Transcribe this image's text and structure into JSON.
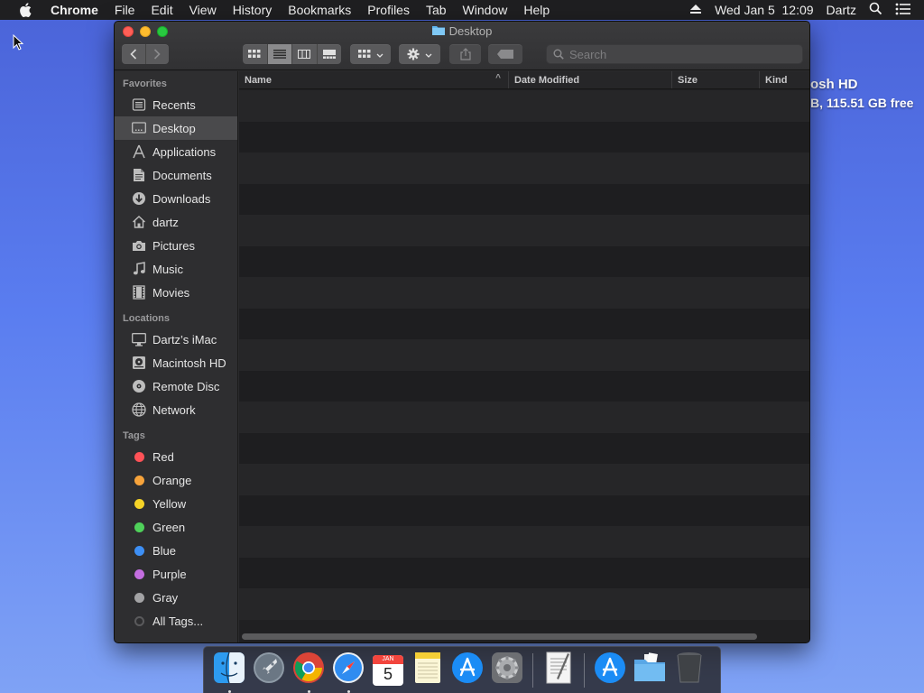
{
  "menubar": {
    "app_name": "Chrome",
    "items": [
      "File",
      "Edit",
      "View",
      "History",
      "Bookmarks",
      "Profiles",
      "Tab",
      "Window",
      "Help"
    ],
    "clock": "Wed Jan 5  12:09",
    "user": "Dartz"
  },
  "desktop": {
    "drive_name": "osh HD",
    "drive_capacity": "B, 115.51 GB free"
  },
  "window": {
    "title": "Desktop",
    "search_placeholder": "Search",
    "columns": [
      {
        "label": "Name"
      },
      {
        "label": "Date Modified"
      },
      {
        "label": "Size"
      },
      {
        "label": "Kind"
      }
    ]
  },
  "sidebar": {
    "favorites_label": "Favorites",
    "favorites": [
      {
        "label": "Recents",
        "icon": "recents-icon"
      },
      {
        "label": "Desktop",
        "icon": "desktop-icon",
        "selected": true
      },
      {
        "label": "Applications",
        "icon": "applications-icon"
      },
      {
        "label": "Documents",
        "icon": "documents-icon"
      },
      {
        "label": "Downloads",
        "icon": "downloads-icon"
      },
      {
        "label": "dartz",
        "icon": "home-icon"
      },
      {
        "label": "Pictures",
        "icon": "camera-icon"
      },
      {
        "label": "Music",
        "icon": "music-note-icon"
      },
      {
        "label": "Movies",
        "icon": "film-icon"
      }
    ],
    "locations_label": "Locations",
    "locations": [
      {
        "label": "Dartz’s iMac",
        "icon": "imac-icon"
      },
      {
        "label": "Macintosh HD",
        "icon": "hard-drive-icon"
      },
      {
        "label": "Remote Disc",
        "icon": "disc-icon"
      },
      {
        "label": "Network",
        "icon": "network-globe-icon"
      }
    ],
    "tags_label": "Tags",
    "tags": [
      {
        "label": "Red",
        "color": "#ff5257"
      },
      {
        "label": "Orange",
        "color": "#f7a33b"
      },
      {
        "label": "Yellow",
        "color": "#f5d327"
      },
      {
        "label": "Green",
        "color": "#4fd15a"
      },
      {
        "label": "Blue",
        "color": "#3d8ff5"
      },
      {
        "label": "Purple",
        "color": "#c46ee0"
      },
      {
        "label": "Gray",
        "color": "#a3a3a5"
      },
      {
        "label": "All Tags...",
        "color": "#5a5a5c"
      }
    ]
  },
  "dock": {
    "apps": [
      {
        "name": "Finder",
        "icon": "finder-icon",
        "running": true
      },
      {
        "name": "Launchpad",
        "icon": "launchpad-rocket-icon",
        "running": false
      },
      {
        "name": "Google Chrome",
        "icon": "chrome-icon",
        "running": true
      },
      {
        "name": "Safari",
        "icon": "safari-compass-icon",
        "running": true
      },
      {
        "name": "Calendar",
        "icon": "calendar-icon",
        "running": false,
        "month": "JAN",
        "day": "5"
      },
      {
        "name": "Notes",
        "icon": "notes-icon",
        "running": false
      },
      {
        "name": "App Store",
        "icon": "app-store-icon",
        "running": false
      },
      {
        "name": "System Preferences",
        "icon": "system-preferences-gear-icon",
        "running": false
      },
      {
        "name": "TextEdit",
        "icon": "textedit-icon",
        "running": false
      },
      {
        "name": "Applications",
        "icon": "applications-stack-icon",
        "running": false
      },
      {
        "name": "Documents",
        "icon": "documents-stack-icon",
        "running": false
      },
      {
        "name": "Trash",
        "icon": "trash-icon",
        "running": false
      }
    ]
  }
}
